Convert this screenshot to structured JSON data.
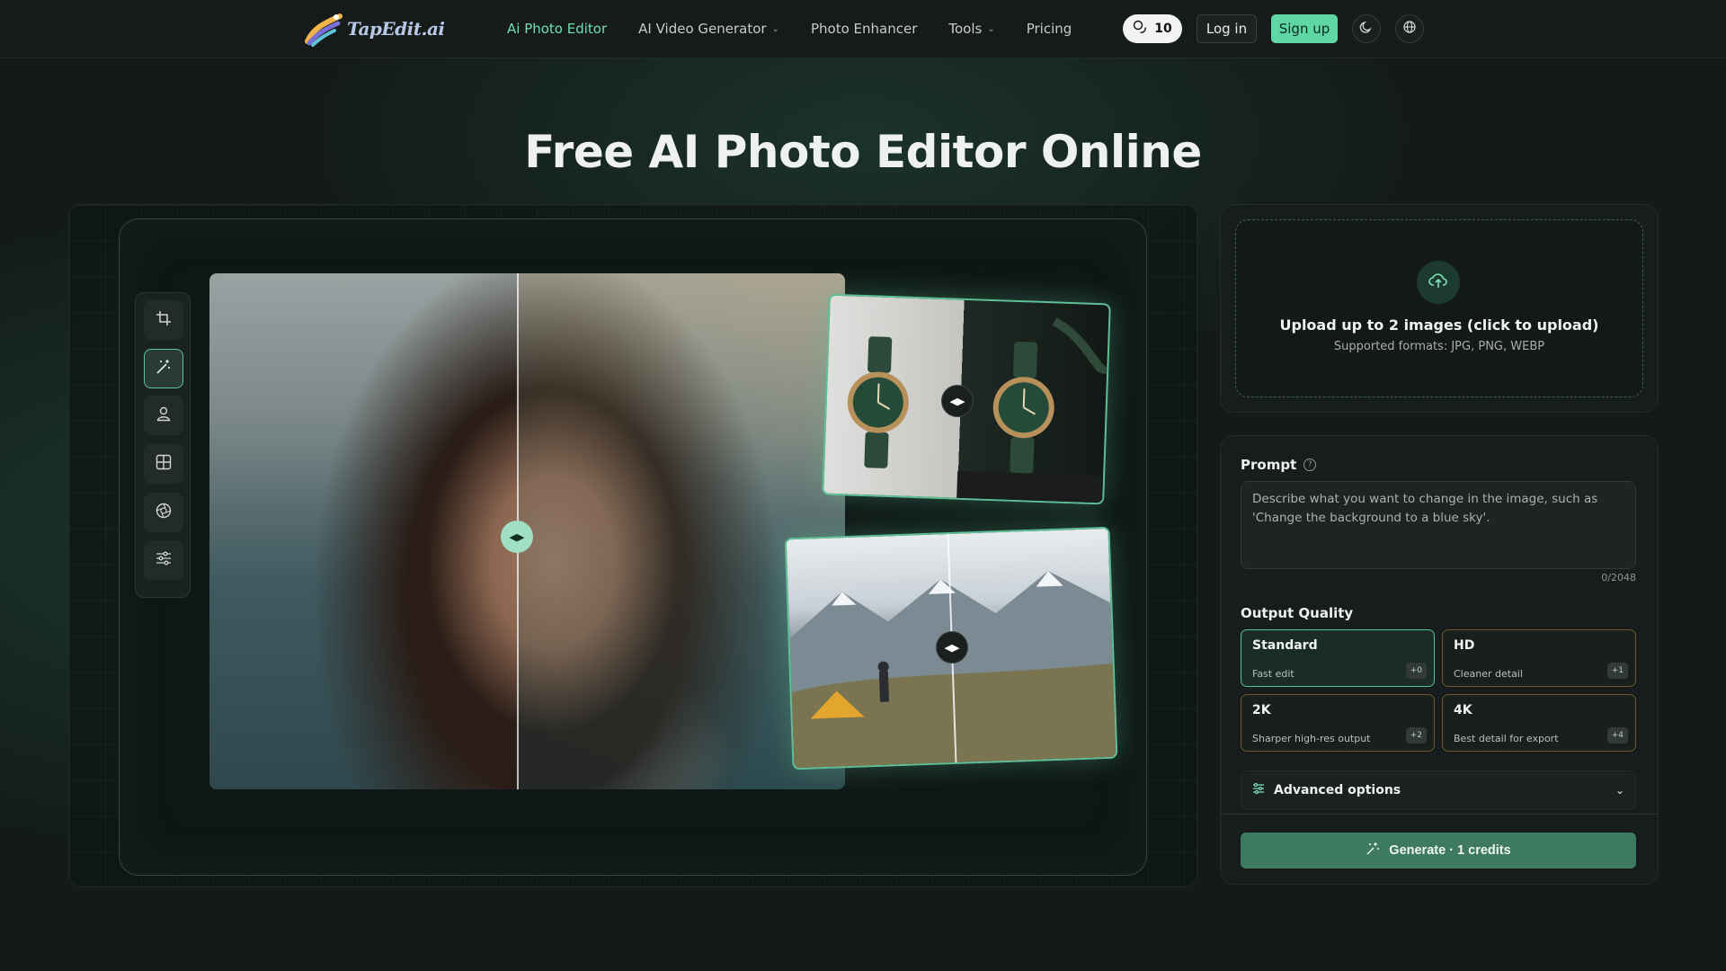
{
  "brand": {
    "name": "TapEdit.ai"
  },
  "nav": {
    "links": [
      {
        "label": "Ai Photo Editor",
        "active": true,
        "dropdown": false
      },
      {
        "label": "AI Video Generator",
        "active": false,
        "dropdown": true
      },
      {
        "label": "Photo Enhancer",
        "active": false,
        "dropdown": false
      },
      {
        "label": "Tools",
        "active": false,
        "dropdown": true
      },
      {
        "label": "Pricing",
        "active": false,
        "dropdown": false
      }
    ],
    "credits": "10",
    "login_label": "Log in",
    "signup_label": "Sign up",
    "theme_icon": "moon-icon",
    "language_icon": "globe-icon"
  },
  "hero": {
    "title": "Free AI Photo Editor Online"
  },
  "toolbar": {
    "tools": [
      "crop-icon",
      "magic-wand-icon",
      "person-icon",
      "grid-icon",
      "aperture-icon",
      "sliders-icon"
    ],
    "active_index": 1
  },
  "upload": {
    "title": "Upload up to 2 images (click to upload)",
    "subtitle": "Supported formats: JPG, PNG, WEBP"
  },
  "prompt": {
    "label": "Prompt",
    "placeholder": "Describe what you want to change in the image, such as 'Change the background to a blue sky'.",
    "value": "",
    "counter": "0/2048"
  },
  "quality": {
    "label": "Output Quality",
    "options": [
      {
        "title": "Standard",
        "desc": "Fast edit",
        "badge": "+0",
        "selected": true
      },
      {
        "title": "HD",
        "desc": "Cleaner detail",
        "badge": "+1",
        "selected": false
      },
      {
        "title": "2K",
        "desc": "Sharper high-res output",
        "badge": "+2",
        "selected": false
      },
      {
        "title": "4K",
        "desc": "Best detail for export",
        "badge": "+4",
        "selected": false
      }
    ]
  },
  "advanced": {
    "label": "Advanced options"
  },
  "generate": {
    "label": "Generate · 1 credits"
  },
  "colors": {
    "accent": "#5ed7a5",
    "active_nav": "#6fe0b0",
    "generate_bg": "#3d7a5f",
    "quality_border": "#6b5a2a"
  }
}
